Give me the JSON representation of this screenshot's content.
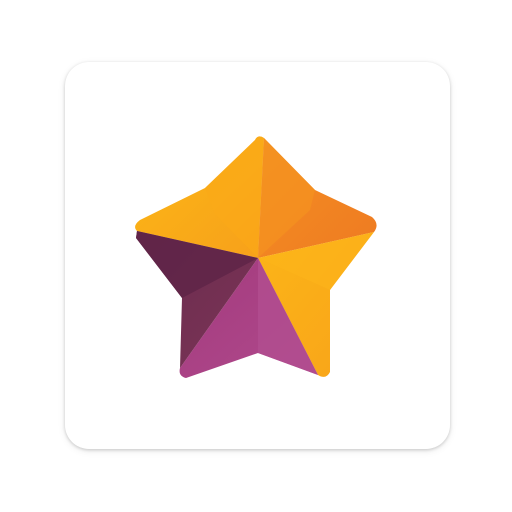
{
  "app_icon": {
    "name": "star-logo",
    "colors": {
      "tile_background": "#ffffff",
      "orange_light": "#fbb116",
      "orange_mid": "#f6a21c",
      "orange_dark": "#ef7d22",
      "purple_dark": "#5e2447",
      "purple_mid": "#7a3254",
      "magenta": "#a83b82",
      "magenta_light": "#b94e92"
    }
  }
}
